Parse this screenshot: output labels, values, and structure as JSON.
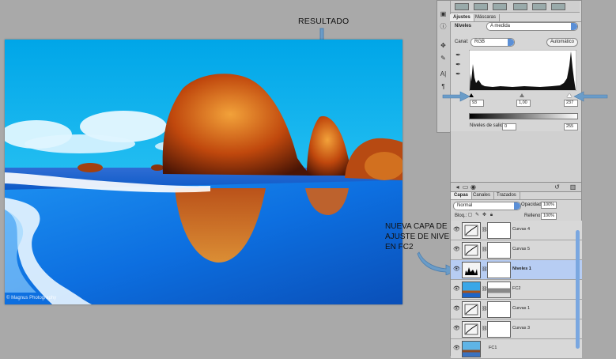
{
  "annotations": {
    "resultado": "RESULTADO",
    "nueva_capa": [
      "NUEVA CAPA DE",
      "AJUSTE DE NIVELES",
      "EN FC2"
    ]
  },
  "photo": {
    "watermark": "© Magnus Photography"
  },
  "adjustments_panel": {
    "tabs": [
      "Ajustes",
      "Máscaras"
    ],
    "preset_label": "Niveles",
    "preset_value": "A medida",
    "channel_label": "Canal:",
    "channel_value": "RGB",
    "auto_button": "Automático",
    "input_values": [
      "93",
      "1,00",
      "237"
    ],
    "output_label": "Niveles de salida:",
    "output_values": [
      "0",
      "255"
    ]
  },
  "layers_panel": {
    "tabs": [
      "Capas",
      "Canales",
      "Trazados"
    ],
    "blend_mode": "Normal",
    "opacity_label": "Opacidad:",
    "opacity_value": "100%",
    "lock_label": "Bloq.:",
    "fill_label": "Relleno:",
    "fill_value": "100%",
    "layers": [
      {
        "name": "Curvas 4"
      },
      {
        "name": "Curvas 5"
      },
      {
        "name": "Niveles 1",
        "selected": true
      },
      {
        "name": "FC2"
      },
      {
        "name": "Curvas 1"
      },
      {
        "name": "Curvas 3"
      },
      {
        "name": "FC1"
      }
    ]
  },
  "colors": {
    "selected_row": "#b7cdf3",
    "accent_blue": "#5b8fd6",
    "arrow": "#6a9cc8"
  }
}
